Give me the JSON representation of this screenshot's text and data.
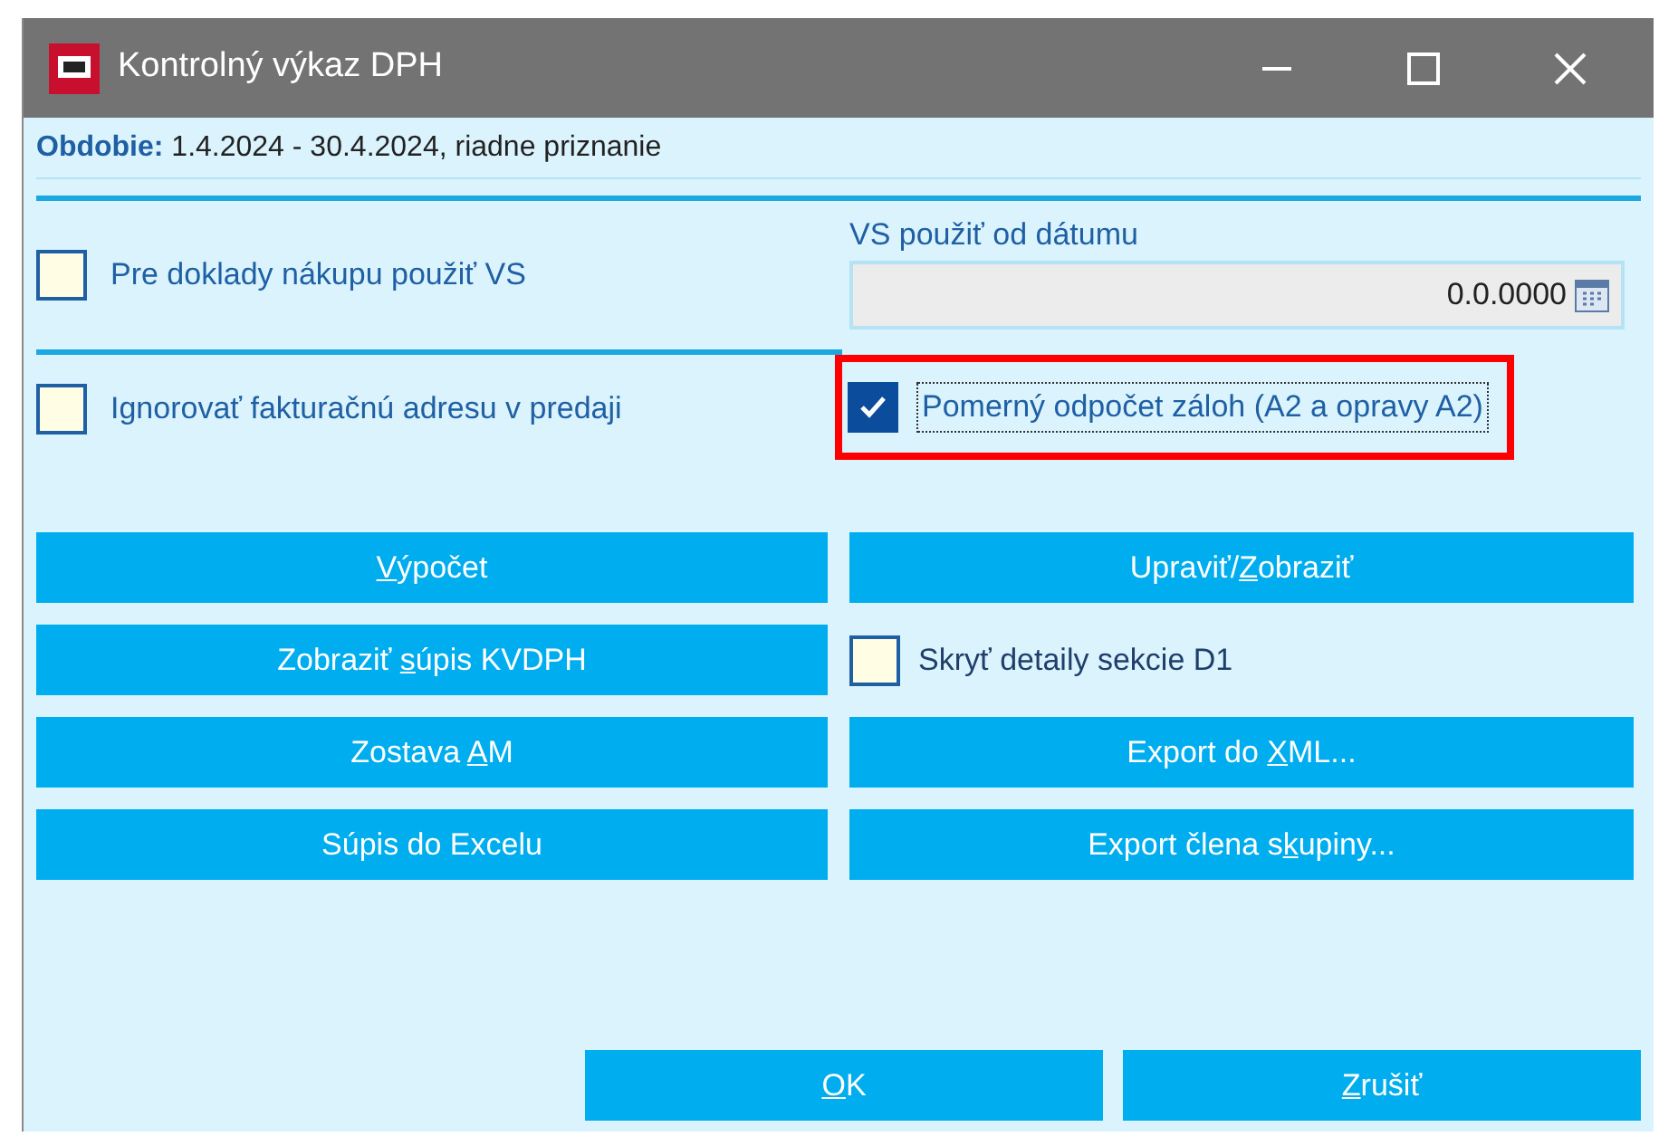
{
  "window": {
    "title": "Kontrolný výkaz DPH"
  },
  "period": {
    "label": "Obdobie:",
    "value": "1.4.2024 - 30.4.2024, riadne priznanie"
  },
  "options": [
    {
      "label": "Pre doklady nákupu použiť VS",
      "checked": false,
      "highlighted": false
    },
    {
      "label": "Ignorovať fakturačnú adresu v predaji",
      "checked": false,
      "highlighted": false
    },
    {
      "label": "Pomerný odpočet záloh (A2 a opravy A2)",
      "checked": true,
      "highlighted": true,
      "focused": true
    }
  ],
  "date_field": {
    "label": "VS použiť od dátumu",
    "value": "0.0.0000"
  },
  "actions": [
    {
      "kind": "button",
      "access_key": "V",
      "after": "ýpočet"
    },
    {
      "kind": "button",
      "before": "Upraviť/",
      "access_key": "Z",
      "after": "obraziť"
    },
    {
      "kind": "button",
      "before": "Zobraziť ",
      "access_key": "s",
      "after": "úpis KVDPH"
    },
    {
      "kind": "checkbox",
      "label": "Skryť detaily sekcie D1",
      "checked": false
    },
    {
      "kind": "button",
      "before": "Zostava ",
      "access_key": "A",
      "after": "M"
    },
    {
      "kind": "button",
      "before": "Export do ",
      "access_key": "X",
      "after": "ML..."
    },
    {
      "kind": "button",
      "before": "Súpis do Excelu"
    },
    {
      "kind": "button",
      "before": "Export člena s",
      "access_key": "k",
      "after": "upiny..."
    }
  ],
  "footer_buttons": [
    {
      "access_key": "O",
      "after": "K"
    },
    {
      "access_key": "Z",
      "after": "rušiť"
    }
  ]
}
